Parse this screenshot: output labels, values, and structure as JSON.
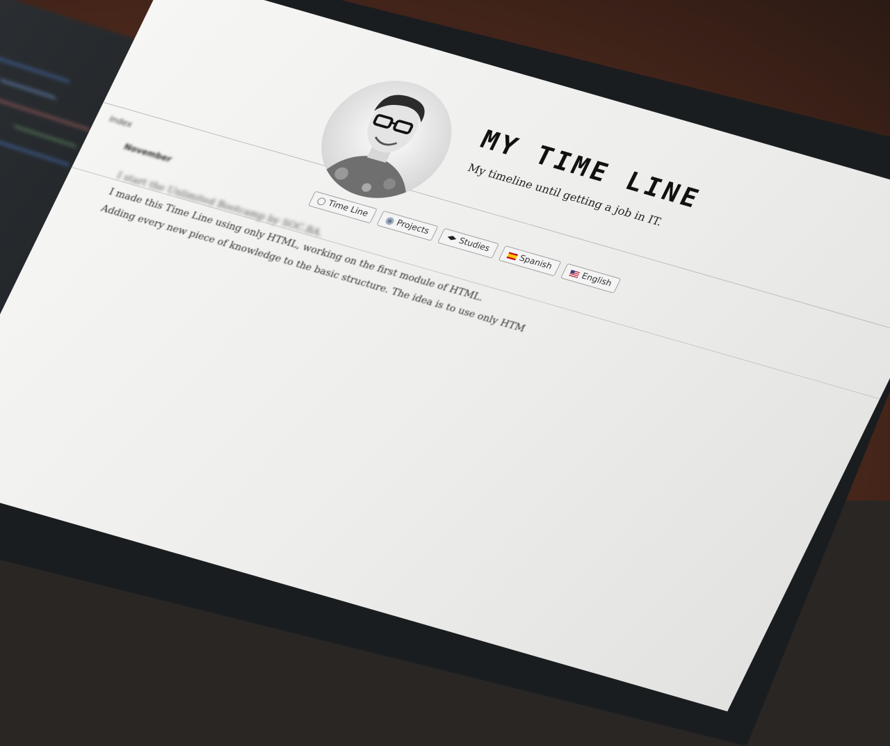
{
  "page": {
    "title": "MY TIME LINE",
    "subtitle": "My timeline until getting a job in IT."
  },
  "nav": {
    "items": [
      {
        "label": "Time Line",
        "icon": "clock-icon"
      },
      {
        "label": "Projects",
        "icon": "gear-icon"
      },
      {
        "label": "Studies",
        "icon": "graduation-cap-icon"
      },
      {
        "label": "Spanish",
        "icon": "spain-flag-icon"
      },
      {
        "label": "English",
        "icon": "us-flag-icon"
      }
    ]
  },
  "content": {
    "side_title": "Index",
    "section_heading": "November",
    "lines": [
      "I start the Unlimited Bootcamp by SOC.BA.",
      "I made this Time Line using only HTML, working on the first module of HTML.",
      "Adding every new piece of knowledge to the basic structure. The idea is to use only HTM"
    ]
  },
  "colors": {
    "screen_bg": "#f0f0ee",
    "title_text": "#111111",
    "link": "#3a5fc8"
  }
}
